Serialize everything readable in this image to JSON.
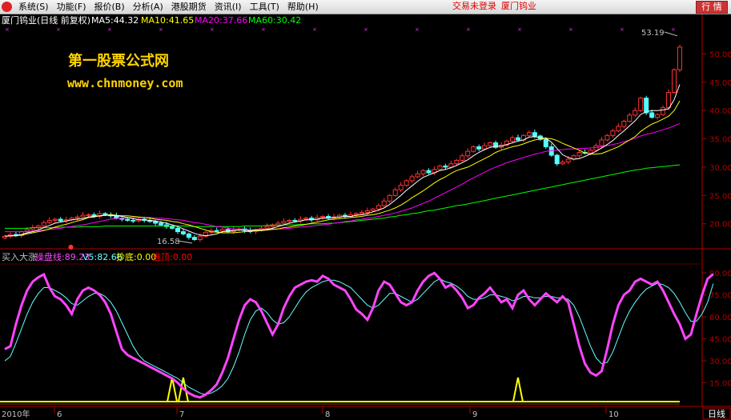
{
  "menubar": {
    "items": [
      "系统(S)",
      "功能(F)",
      "报价(B)",
      "分析(A)",
      "港股期货",
      "资讯(I)",
      "工具(T)",
      "帮助(H)"
    ],
    "status_login": "交易未登录",
    "status_stock": "厦门钨业",
    "quote_button": "行 情"
  },
  "price_panel": {
    "title": "厦门钨业(日线 前复权)",
    "ma5": "MA5:44.32",
    "ma10": "MA10:41.65",
    "ma20": "MA20:37.66",
    "ma60": "MA60:30.42",
    "high_label": "53.19",
    "low_label": "16.58",
    "watermark_line1": "第一股票公式网",
    "watermark_line2": "www.chnmoney.com",
    "colors": {
      "ma5": "#ffffff",
      "ma10": "#ffff00",
      "ma20": "#ff00ff",
      "ma60": "#00ff00",
      "up": "#ff3232",
      "down": "#54ffff",
      "axis": "#b00000"
    }
  },
  "indicator_panel": {
    "name": "买入大涨",
    "main_line": "操盘线:89.23",
    "v5": "V5:82.66",
    "bottom": "抄底:0.00",
    "escape": "逃顶:0.00",
    "colors": {
      "main": "#ff44ff",
      "v5": "#66ffff",
      "bottom": "#ffff00",
      "escape": "#ff0000"
    }
  },
  "bottom_bar": {
    "period": "日线",
    "axis_labels": [
      "2010年",
      "6",
      "7",
      "8",
      "9",
      "10"
    ]
  },
  "chart_data": [
    {
      "type": "candlestick",
      "ylim": [
        16,
        55
      ],
      "y_ticks": [
        20,
        25,
        30,
        35,
        40,
        45,
        50
      ],
      "y_tick_labels": [
        "20.00",
        "25.00",
        "30.00",
        "35.00",
        "40.00",
        "45.00",
        "50.00"
      ],
      "close": [
        17.8,
        18.1,
        17.9,
        18.6,
        19.0,
        19.3,
        19.6,
        20.2,
        20.6,
        20.8,
        20.5,
        20.7,
        21.0,
        21.2,
        21.5,
        21.6,
        21.3,
        21.8,
        21.6,
        21.4,
        21.0,
        20.8,
        20.6,
        20.5,
        20.8,
        20.6,
        20.4,
        20.1,
        19.8,
        19.5,
        19.2,
        18.6,
        18.2,
        17.6,
        17.2,
        17.8,
        18.5,
        18.8,
        18.7,
        19.0,
        18.6,
        18.9,
        19.1,
        18.8,
        18.6,
        18.9,
        19.2,
        19.5,
        19.8,
        20.1,
        20.4,
        20.6,
        20.5,
        20.8,
        21.0,
        20.7,
        21.1,
        21.3,
        21.0,
        21.2,
        21.5,
        21.3,
        21.6,
        21.8,
        22.0,
        22.3,
        22.6,
        23.2,
        24.0,
        25.0,
        26.0,
        26.8,
        27.6,
        28.3,
        28.8,
        29.4,
        29.0,
        29.6,
        30.2,
        30.0,
        30.6,
        31.2,
        32.0,
        32.8,
        33.6,
        33.2,
        33.8,
        34.3,
        33.5,
        33.9,
        34.6,
        35.2,
        34.8,
        35.6,
        36.1,
        35.5,
        34.9,
        33.6,
        32.1,
        30.6,
        30.9,
        31.4,
        32.0,
        32.6,
        32.5,
        33.0,
        33.8,
        34.8,
        35.6,
        36.4,
        37.2,
        38.1,
        39.2,
        40.0,
        42.2,
        39.6,
        38.8,
        39.3,
        40.5,
        43.2,
        47.2,
        51.2
      ],
      "ma5": [
        17.8,
        17.9,
        17.9,
        18.1,
        18.4,
        18.6,
        18.9,
        19.3,
        19.7,
        20.1,
        20.3,
        20.5,
        20.7,
        20.8,
        20.9,
        21.2,
        21.3,
        21.4,
        21.5,
        21.5,
        21.4,
        21.3,
        21.1,
        20.9,
        20.7,
        20.7,
        20.6,
        20.5,
        20.3,
        20.1,
        19.8,
        19.5,
        19.1,
        18.7,
        18.3,
        18.0,
        17.9,
        18.0,
        18.2,
        18.6,
        18.7,
        18.8,
        18.9,
        18.9,
        18.8,
        18.9,
        18.9,
        19.0,
        19.2,
        19.5,
        19.8,
        20.1,
        20.3,
        20.5,
        20.7,
        20.7,
        20.8,
        21.0,
        21.0,
        21.1,
        21.2,
        21.3,
        21.3,
        21.5,
        21.6,
        21.8,
        22.1,
        22.4,
        22.8,
        23.4,
        24.2,
        25.0,
        25.9,
        26.7,
        27.5,
        28.2,
        28.6,
        29.0,
        29.4,
        29.6,
        29.9,
        30.3,
        30.8,
        31.3,
        32.0,
        32.6,
        33.1,
        33.5,
        33.7,
        33.7,
        34.0,
        34.3,
        34.6,
        34.8,
        35.3,
        35.4,
        35.2,
        35.1,
        34.4,
        33.3,
        32.2,
        31.7,
        31.4,
        31.5,
        31.9,
        32.3,
        32.8,
        33.4,
        34.0,
        34.7,
        35.6,
        36.4,
        37.3,
        38.2,
        39.3,
        39.8,
        40.0,
        40.0,
        40.1,
        40.3,
        41.9,
        44.6
      ],
      "ma10": [
        17.8,
        17.9,
        17.9,
        18.0,
        18.2,
        18.4,
        18.6,
        18.8,
        19.1,
        19.4,
        19.7,
        19.9,
        20.2,
        20.5,
        20.7,
        21.1,
        21.2,
        21.4,
        21.5,
        21.6,
        21.5,
        21.4,
        21.4,
        21.3,
        21.2,
        21.1,
        21.0,
        20.8,
        20.7,
        20.6,
        20.4,
        20.3,
        20.0,
        19.8,
        19.5,
        19.2,
        18.9,
        18.6,
        18.5,
        18.4,
        18.4,
        18.4,
        18.5,
        18.6,
        18.7,
        18.8,
        18.8,
        18.9,
        19.0,
        19.1,
        19.3,
        19.4,
        19.6,
        19.7,
        19.9,
        20.1,
        20.3,
        20.5,
        20.7,
        20.8,
        20.9,
        21.0,
        21.1,
        21.2,
        21.3,
        21.5,
        21.6,
        21.8,
        22.1,
        22.4,
        22.8,
        23.3,
        23.9,
        24.6,
        25.2,
        25.8,
        26.5,
        27.2,
        27.8,
        28.3,
        28.9,
        29.4,
        29.7,
        30.0,
        30.5,
        31.0,
        31.5,
        32.0,
        32.6,
        33.0,
        33.3,
        33.6,
        33.8,
        34.1,
        34.5,
        34.8,
        35.0,
        35.1,
        35.0,
        34.7,
        34.2,
        33.8,
        33.4,
        33.0,
        32.5,
        32.3,
        32.3,
        32.4,
        32.8,
        33.2,
        33.6,
        34.2,
        34.8,
        35.4,
        36.3,
        37.0,
        37.6,
        38.0,
        38.5,
        39.0,
        40.0,
        41.7
      ],
      "ma20": [
        18.6,
        18.6,
        18.6,
        18.6,
        18.7,
        18.7,
        18.8,
        18.9,
        19.0,
        19.1,
        19.2,
        19.4,
        19.5,
        19.7,
        19.8,
        20.0,
        20.2,
        20.4,
        20.6,
        20.8,
        20.9,
        21.0,
        21.1,
        21.1,
        21.1,
        21.1,
        21.1,
        21.0,
        21.0,
        20.9,
        20.8,
        20.7,
        20.6,
        20.4,
        20.2,
        20.1,
        19.9,
        19.7,
        19.5,
        19.4,
        19.2,
        19.1,
        19.0,
        19.0,
        18.9,
        19.0,
        19.0,
        19.0,
        19.0,
        19.1,
        19.1,
        19.2,
        19.3,
        19.4,
        19.5,
        19.6,
        19.7,
        19.8,
        19.9,
        20.1,
        20.2,
        20.4,
        20.5,
        20.7,
        20.8,
        21.0,
        21.1,
        21.3,
        21.5,
        21.7,
        21.9,
        22.2,
        22.5,
        22.8,
        23.2,
        23.6,
        24.0,
        24.5,
        25.0,
        25.5,
        26.0,
        26.5,
        27.0,
        27.6,
        28.1,
        28.6,
        29.1,
        29.6,
        30.0,
        30.4,
        30.8,
        31.1,
        31.4,
        31.7,
        32.0,
        32.3,
        32.5,
        32.8,
        32.9,
        33.0,
        33.1,
        33.2,
        33.2,
        33.3,
        33.3,
        33.4,
        33.5,
        33.6,
        33.8,
        34.0,
        34.2,
        34.5,
        34.8,
        35.1,
        35.5,
        35.8,
        36.0,
        36.3,
        36.6,
        36.9,
        37.3,
        37.7
      ],
      "ma60": [
        19.2,
        19.2,
        19.2,
        19.2,
        19.2,
        19.3,
        19.3,
        19.3,
        19.3,
        19.3,
        19.4,
        19.4,
        19.4,
        19.4,
        19.5,
        19.5,
        19.5,
        19.5,
        19.6,
        19.6,
        19.6,
        19.6,
        19.6,
        19.6,
        19.6,
        19.6,
        19.6,
        19.6,
        19.6,
        19.6,
        19.6,
        19.6,
        19.6,
        19.6,
        19.5,
        19.5,
        19.5,
        19.5,
        19.5,
        19.5,
        19.5,
        19.5,
        19.5,
        19.6,
        19.6,
        19.6,
        19.6,
        19.7,
        19.7,
        19.7,
        19.8,
        19.8,
        19.8,
        19.9,
        19.9,
        20.0,
        20.0,
        20.0,
        20.1,
        20.1,
        20.2,
        20.3,
        20.4,
        20.5,
        20.6,
        20.7,
        20.8,
        20.9,
        21.0,
        21.2,
        21.3,
        21.5,
        21.6,
        21.8,
        21.9,
        22.1,
        22.3,
        22.4,
        22.6,
        22.8,
        23.0,
        23.2,
        23.3,
        23.5,
        23.7,
        23.9,
        24.1,
        24.3,
        24.5,
        24.7,
        24.9,
        25.1,
        25.3,
        25.5,
        25.7,
        25.9,
        26.1,
        26.3,
        26.5,
        26.7,
        26.9,
        27.1,
        27.3,
        27.5,
        27.7,
        27.9,
        28.1,
        28.3,
        28.5,
        28.7,
        28.9,
        29.1,
        29.3,
        29.5,
        29.6,
        29.8,
        29.9,
        30.0,
        30.1,
        30.2,
        30.3,
        30.4
      ],
      "annotations": [
        {
          "label": "53.19",
          "value": 53.19
        },
        {
          "label": "16.58",
          "value": 16.58
        }
      ]
    },
    {
      "type": "line",
      "ylim": [
        0,
        95
      ],
      "y_ticks": [
        15,
        30,
        45,
        60,
        75,
        90
      ],
      "y_tick_labels": [
        "15.00",
        "30.00",
        "45.00",
        "60.00",
        "75.00",
        "90.00"
      ],
      "series": [
        {
          "name": "操盘线",
          "values": [
            38,
            40,
            55,
            68,
            78,
            84,
            87,
            89,
            80,
            74,
            72,
            68,
            62,
            72,
            78,
            80,
            78,
            75,
            70,
            62,
            50,
            38,
            34,
            32,
            30,
            28,
            26,
            24,
            22,
            20,
            18,
            15,
            11,
            8,
            6,
            5,
            7,
            10,
            14,
            22,
            32,
            45,
            58,
            68,
            72,
            70,
            64,
            56,
            48,
            55,
            66,
            74,
            80,
            82,
            84,
            85,
            84,
            88,
            86,
            82,
            80,
            78,
            72,
            65,
            62,
            58,
            66,
            78,
            84,
            82,
            76,
            70,
            68,
            70,
            78,
            84,
            88,
            90,
            86,
            80,
            82,
            78,
            73,
            66,
            68,
            73,
            76,
            80,
            75,
            70,
            72,
            66,
            75,
            78,
            72,
            68,
            72,
            76,
            73,
            70,
            74,
            70,
            55,
            40,
            28,
            22,
            20,
            23,
            38,
            55,
            68,
            75,
            78,
            84,
            86,
            84,
            82,
            84,
            78,
            70,
            62,
            55,
            45,
            48,
            62,
            75,
            86,
            89.23
          ]
        },
        {
          "name": "V5",
          "values": [
            30,
            33,
            42,
            52,
            62,
            70,
            76,
            80,
            80,
            78,
            76,
            73,
            69,
            68,
            71,
            74,
            76,
            76,
            74,
            70,
            64,
            56,
            48,
            40,
            34,
            30,
            28,
            26,
            24,
            22,
            20,
            18,
            15,
            12,
            10,
            8,
            7,
            8,
            10,
            13,
            18,
            26,
            36,
            48,
            58,
            64,
            66,
            63,
            58,
            55,
            56,
            60,
            66,
            72,
            77,
            80,
            82,
            84,
            85,
            85,
            84,
            82,
            80,
            76,
            72,
            68,
            66,
            68,
            72,
            76,
            76,
            74,
            72,
            70,
            72,
            76,
            80,
            84,
            86,
            84,
            83,
            81,
            78,
            74,
            72,
            72,
            73,
            75,
            75,
            74,
            73,
            71,
            72,
            74,
            74,
            73,
            73,
            74,
            74,
            73,
            73,
            72,
            68,
            60,
            50,
            40,
            32,
            28,
            29,
            36,
            46,
            56,
            64,
            70,
            75,
            79,
            81,
            83,
            82,
            80,
            76,
            70,
            63,
            57,
            57,
            62,
            70,
            82.66
          ]
        }
      ],
      "signals": [
        {
          "name": "抄底",
          "type": "spike",
          "positions": [
            30,
            32,
            92
          ]
        }
      ]
    }
  ]
}
